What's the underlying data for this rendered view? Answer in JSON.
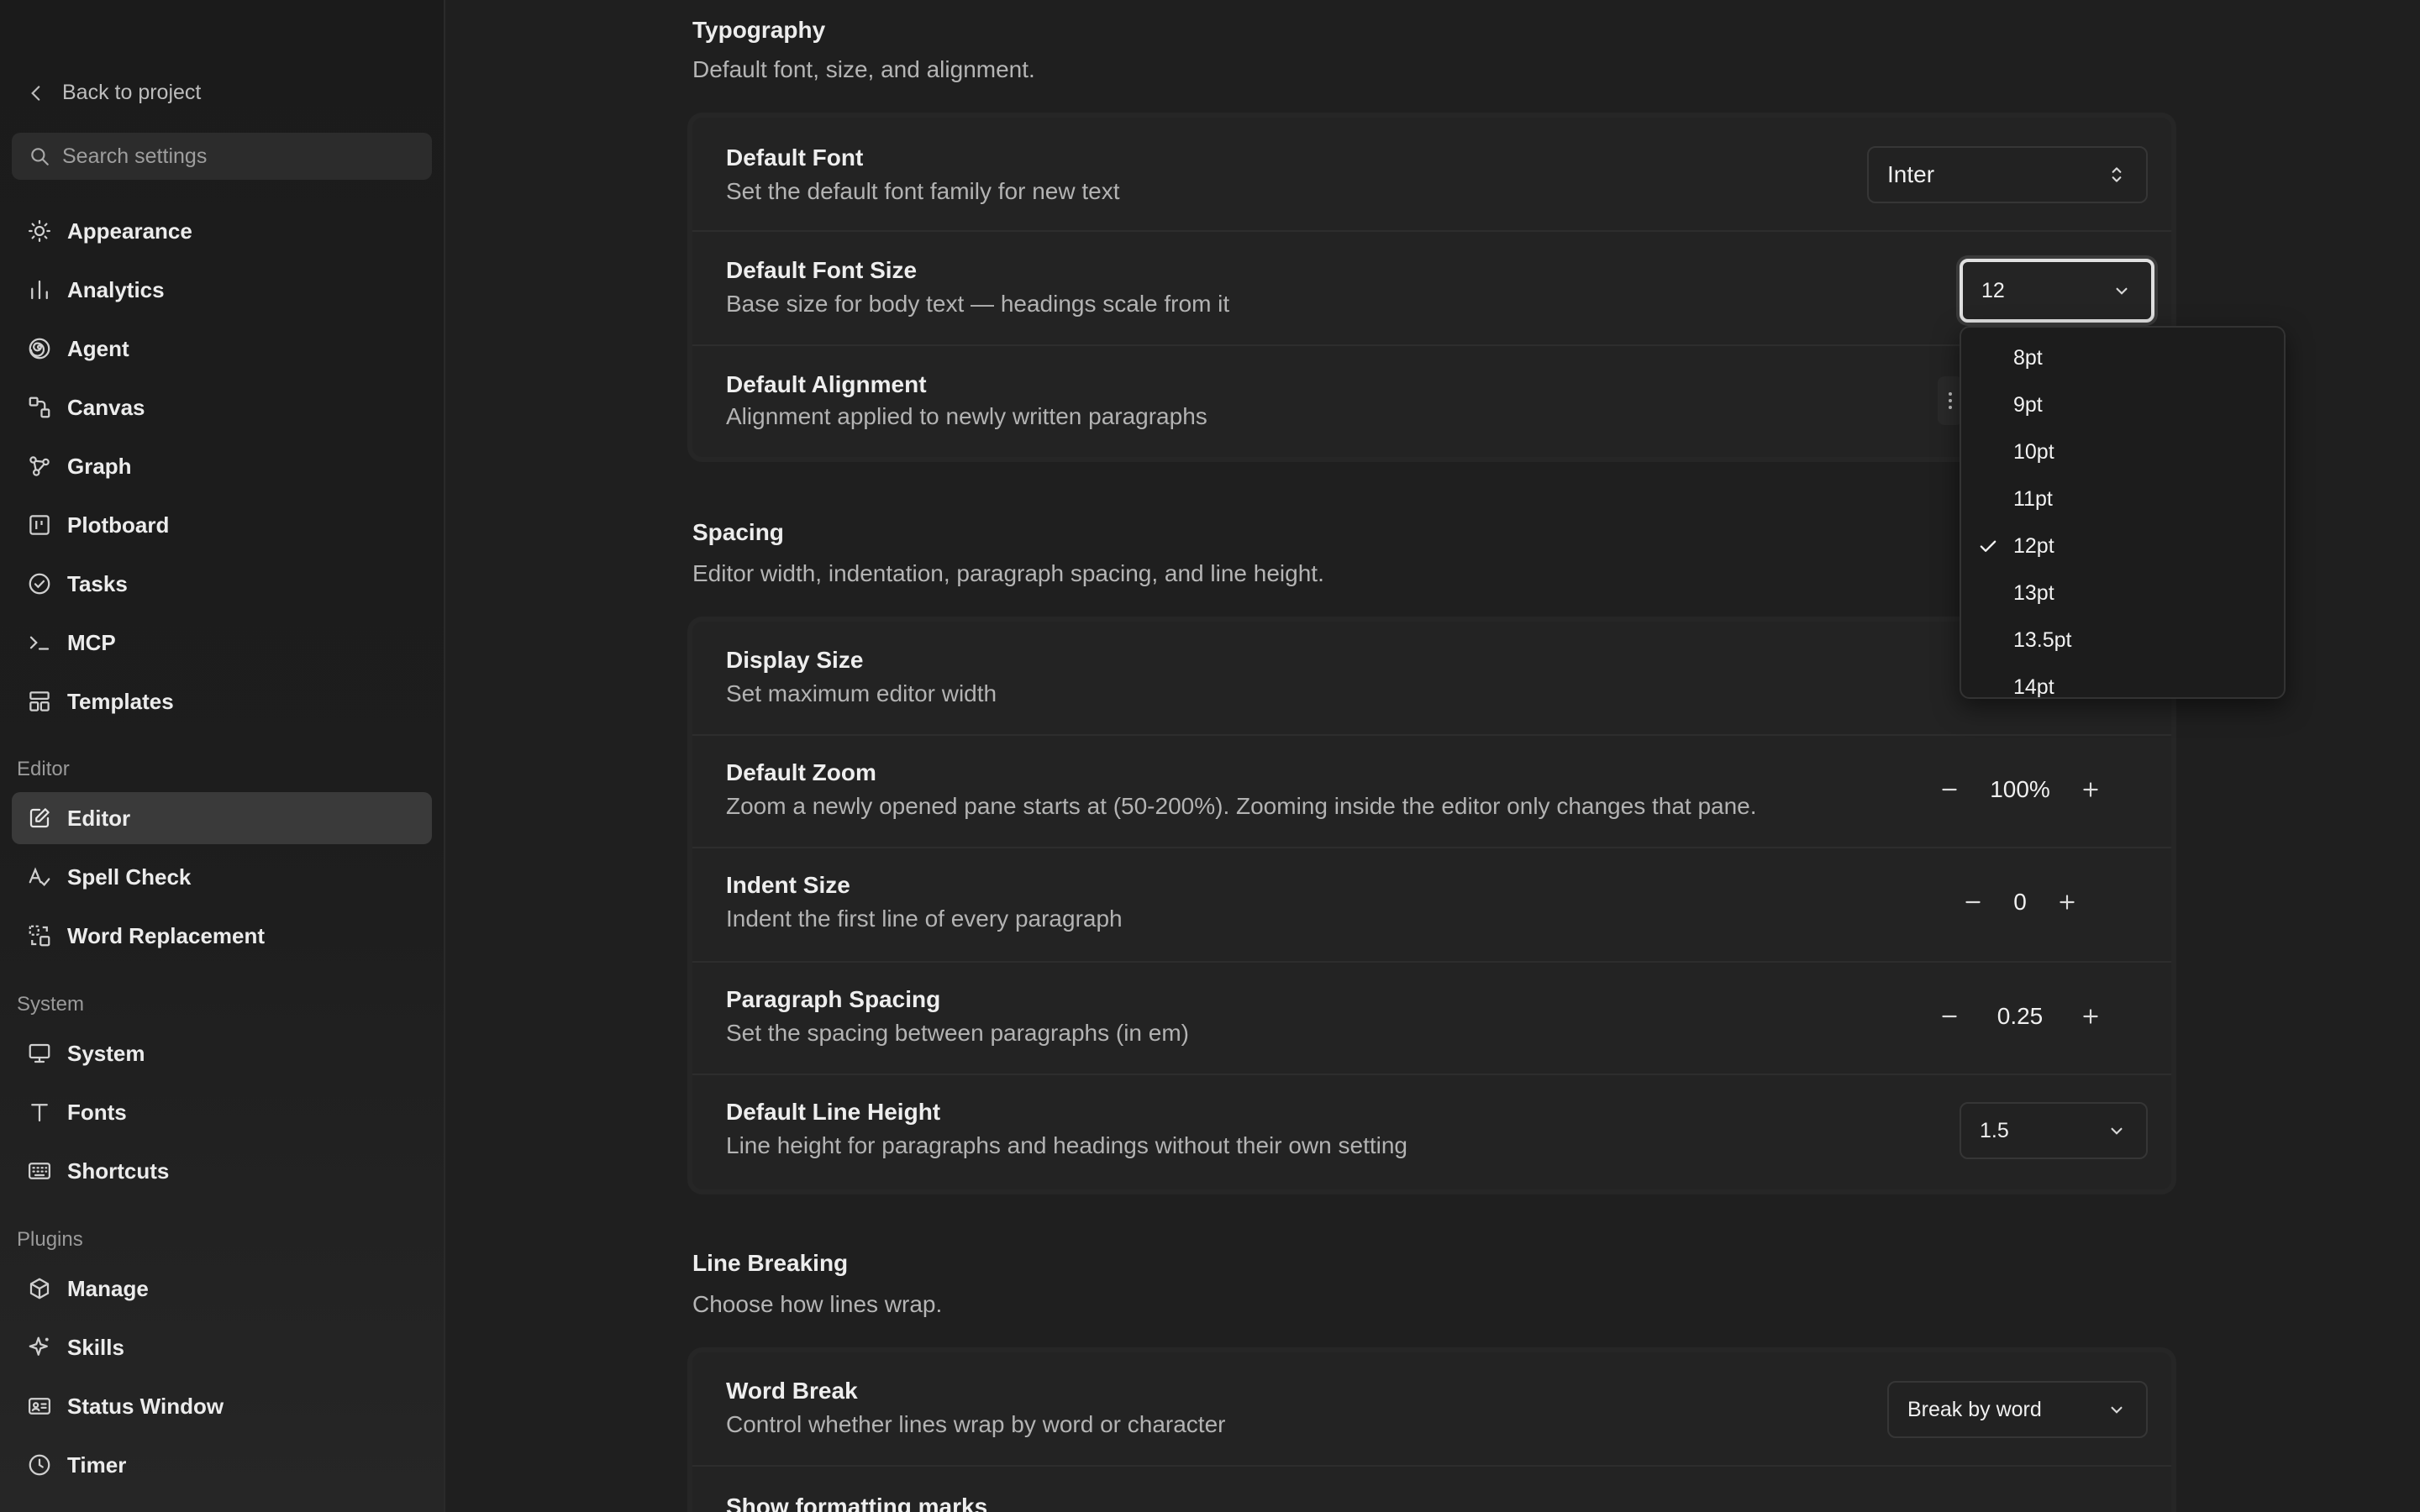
{
  "sidebar": {
    "back_label": "Back to project",
    "search_placeholder": "Search settings",
    "items_general": [
      {
        "label": "Appearance",
        "icon": "sun-icon"
      },
      {
        "label": "Analytics",
        "icon": "bar-chart-icon"
      },
      {
        "label": "Agent",
        "icon": "spiral-icon"
      },
      {
        "label": "Canvas",
        "icon": "canvas-icon"
      },
      {
        "label": "Graph",
        "icon": "graph-icon"
      },
      {
        "label": "Plotboard",
        "icon": "board-icon"
      },
      {
        "label": "Tasks",
        "icon": "check-circle-icon"
      },
      {
        "label": "MCP",
        "icon": "terminal-icon"
      },
      {
        "label": "Templates",
        "icon": "templates-icon"
      }
    ],
    "group_editor": "Editor",
    "items_editor": [
      {
        "label": "Editor",
        "icon": "pencil-square-icon",
        "active": true
      },
      {
        "label": "Spell Check",
        "icon": "spellcheck-icon"
      },
      {
        "label": "Word Replacement",
        "icon": "replace-icon"
      }
    ],
    "group_system": "System",
    "items_system": [
      {
        "label": "System",
        "icon": "monitor-icon"
      },
      {
        "label": "Fonts",
        "icon": "type-icon"
      },
      {
        "label": "Shortcuts",
        "icon": "keyboard-icon"
      }
    ],
    "group_plugins": "Plugins",
    "items_plugins": [
      {
        "label": "Manage",
        "icon": "package-icon"
      },
      {
        "label": "Skills",
        "icon": "sparkle-icon"
      },
      {
        "label": "Status Window",
        "icon": "id-card-icon"
      },
      {
        "label": "Timer",
        "icon": "clock-icon"
      }
    ]
  },
  "typography": {
    "title": "Typography",
    "desc": "Default font, size, and alignment.",
    "default_font": {
      "title": "Default Font",
      "desc": "Set the default font family for new text",
      "value": "Inter"
    },
    "default_font_size": {
      "title": "Default Font Size",
      "desc": "Base size for body text — headings scale from it",
      "value": "12"
    },
    "default_alignment": {
      "title": "Default Alignment",
      "desc": "Alignment applied to newly written paragraphs"
    }
  },
  "spacing": {
    "title": "Spacing",
    "desc": "Editor width, indentation, paragraph spacing, and line height.",
    "display_size": {
      "title": "Display Size",
      "desc": "Set maximum editor width"
    },
    "default_zoom": {
      "title": "Default Zoom",
      "desc": "Zoom a newly opened pane starts at (50-200%). Zooming inside the editor only changes that pane.",
      "value": "100%"
    },
    "indent_size": {
      "title": "Indent Size",
      "desc": "Indent the first line of every paragraph",
      "value": "0"
    },
    "paragraph_spacing": {
      "title": "Paragraph Spacing",
      "desc": "Set the spacing between paragraphs (in em)",
      "value": "0.25"
    },
    "line_height": {
      "title": "Default Line Height",
      "desc": "Line height for paragraphs and headings without their own setting",
      "value": "1.5"
    }
  },
  "line_breaking": {
    "title": "Line Breaking",
    "desc": "Choose how lines wrap.",
    "word_break": {
      "title": "Word Break",
      "desc": "Control whether lines wrap by word or character",
      "value": "Break by word"
    },
    "formatting_marks": {
      "title": "Show formatting marks"
    }
  },
  "font_size_dropdown": {
    "options": [
      "8pt",
      "9pt",
      "10pt",
      "11pt",
      "12pt",
      "13pt",
      "13.5pt",
      "14pt"
    ],
    "selected": "12pt"
  }
}
